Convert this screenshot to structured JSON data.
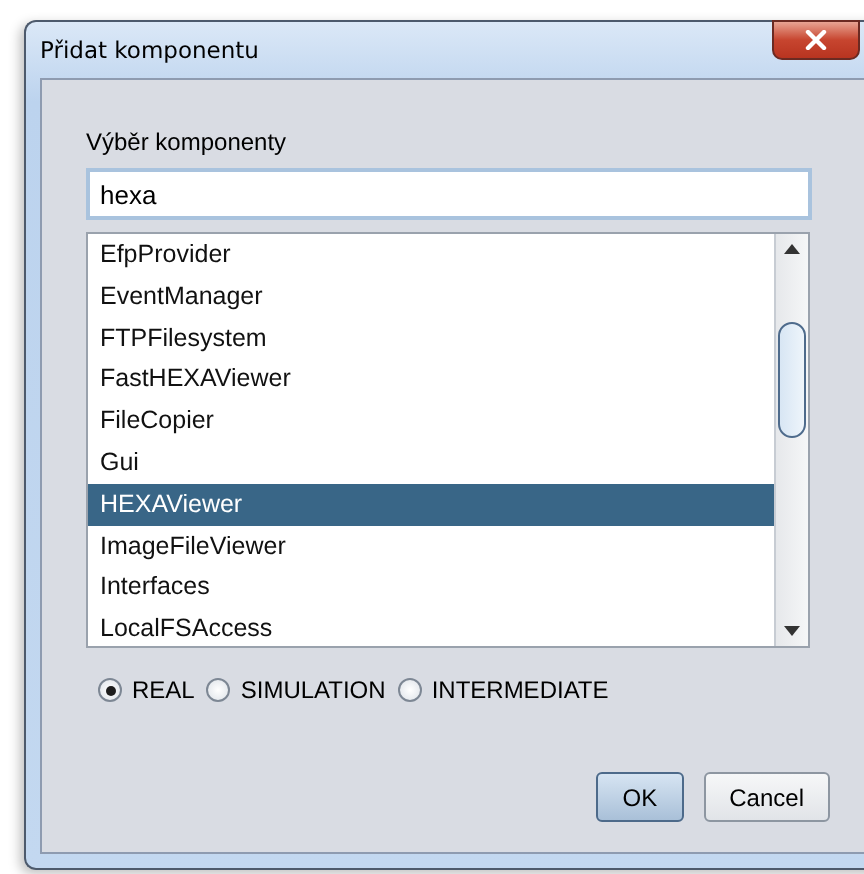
{
  "window": {
    "title": "Přidat komponentu"
  },
  "label": "Výběr komponenty",
  "search": {
    "value": "hexa"
  },
  "items": [
    {
      "label": "EfpProvider",
      "selected": false
    },
    {
      "label": "EventManager",
      "selected": false
    },
    {
      "label": "FTPFilesystem",
      "selected": false
    },
    {
      "label": "FastHEXAViewer",
      "selected": false
    },
    {
      "label": "FileCopier",
      "selected": false
    },
    {
      "label": "Gui",
      "selected": false
    },
    {
      "label": "HEXAViewer",
      "selected": true
    },
    {
      "label": "ImageFileViewer",
      "selected": false
    },
    {
      "label": "Interfaces",
      "selected": false
    },
    {
      "label": "LocalFSAccess",
      "selected": false
    }
  ],
  "modes": [
    {
      "label": "REAL",
      "selected": true
    },
    {
      "label": "SIMULATION",
      "selected": false
    },
    {
      "label": "INTERMEDIATE",
      "selected": false
    }
  ],
  "buttons": [
    {
      "label": "OK",
      "default": true
    },
    {
      "label": "Cancel",
      "default": false
    }
  ]
}
